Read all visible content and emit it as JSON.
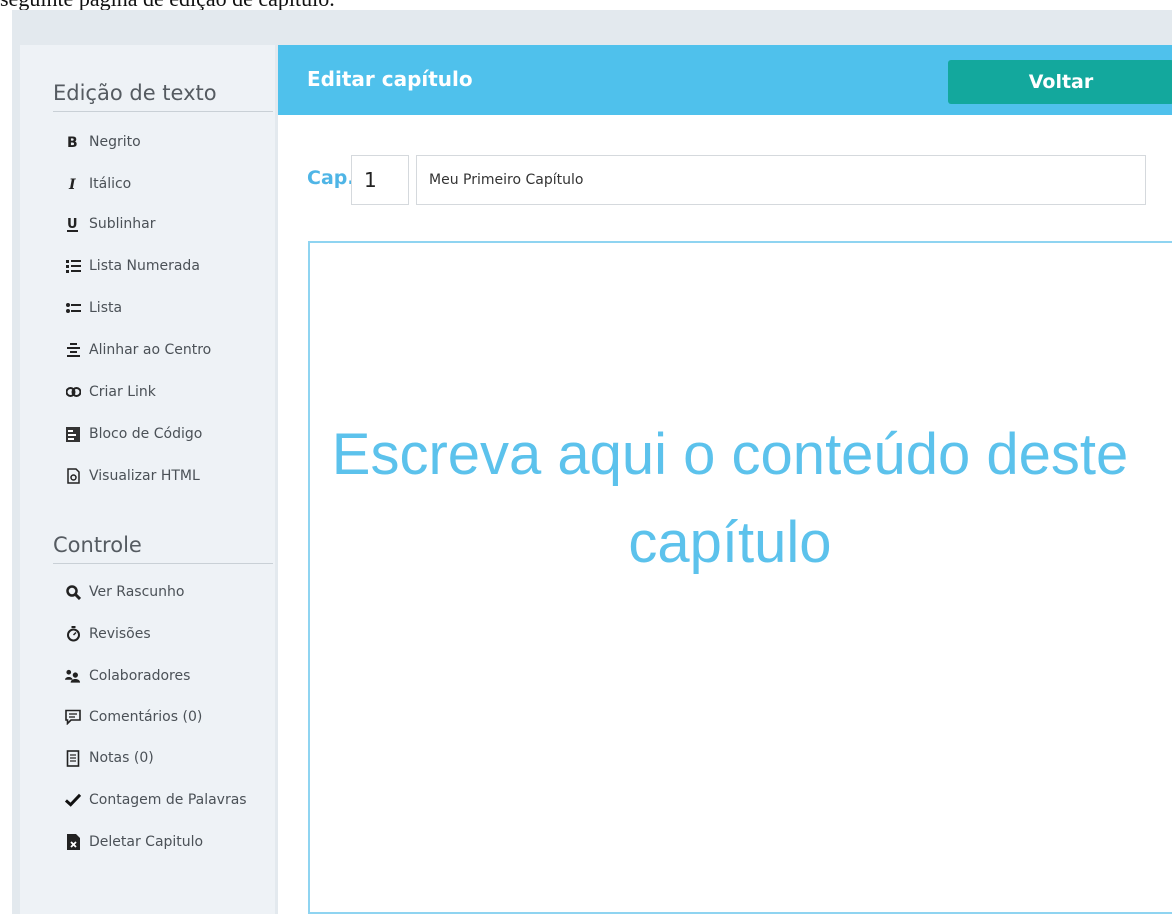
{
  "caption": "seguinte página de edição de capítulo.",
  "sidebar": {
    "text_editing_title": "Edição de texto",
    "text_editing_items": [
      {
        "label": "Negrito",
        "icon": "bold-icon"
      },
      {
        "label": "Itálico",
        "icon": "italic-icon"
      },
      {
        "label": "Sublinhar",
        "icon": "underline-icon"
      },
      {
        "label": "Lista Numerada",
        "icon": "numbered-list-icon"
      },
      {
        "label": "Lista",
        "icon": "bullet-list-icon"
      },
      {
        "label": "Alinhar ao Centro",
        "icon": "align-center-icon"
      },
      {
        "label": "Criar Link",
        "icon": "link-icon"
      },
      {
        "label": "Bloco de Código",
        "icon": "code-block-icon"
      },
      {
        "label": "Visualizar HTML",
        "icon": "view-html-icon"
      }
    ],
    "control_title": "Controle",
    "control_items": [
      {
        "label": "Ver Rascunho",
        "icon": "search-icon"
      },
      {
        "label": "Revisões",
        "icon": "timer-icon"
      },
      {
        "label": "Colaboradores",
        "icon": "users-icon"
      },
      {
        "label": "Comentários (0)",
        "icon": "comment-icon"
      },
      {
        "label": "Notas (0)",
        "icon": "notes-icon"
      },
      {
        "label": "Contagem de Palavras",
        "icon": "checkmark-icon"
      },
      {
        "label": "Deletar Capitulo",
        "icon": "delete-file-icon"
      }
    ]
  },
  "header": {
    "title": "Editar capítulo",
    "back_label": "Voltar"
  },
  "chapter": {
    "prefix": "Cap.",
    "number": "1",
    "title": "Meu Primeiro Capítulo"
  },
  "editor": {
    "placeholder": "Escreva aqui o conteúdo deste capítulo"
  },
  "colors": {
    "header": "#4fc1ec",
    "back_button": "#13a89d",
    "accent_text": "#5cc2ec",
    "sidebar_bg": "#eef2f6"
  }
}
